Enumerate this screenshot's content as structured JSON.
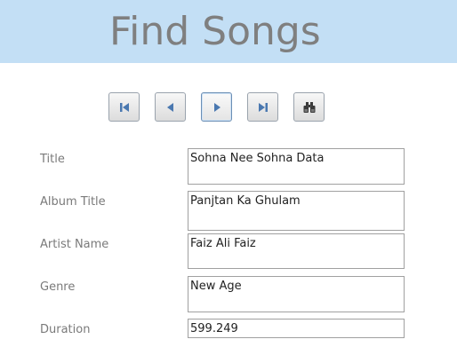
{
  "header": {
    "title": "Find Songs",
    "background": "#c3dff5",
    "title_color": "#7f7f7f"
  },
  "navigation": {
    "buttons": [
      {
        "name": "first-record",
        "icon": "first-record-icon"
      },
      {
        "name": "previous-record",
        "icon": "previous-record-icon"
      },
      {
        "name": "next-record",
        "icon": "next-record-icon",
        "active": true
      },
      {
        "name": "last-record",
        "icon": "last-record-icon"
      },
      {
        "name": "find",
        "icon": "binoculars-icon"
      }
    ],
    "icon_color": "#4a78b0"
  },
  "form": {
    "title": {
      "label": "Title",
      "value": "Sohna Nee Sohna Data"
    },
    "album_title": {
      "label": "Album Title",
      "value": "Panjtan Ka Ghulam"
    },
    "artist_name": {
      "label": "Artist Name",
      "value": "Faiz Ali Faiz"
    },
    "genre": {
      "label": "Genre",
      "value": "New Age"
    },
    "duration": {
      "label": "Duration",
      "value": "599.249"
    }
  }
}
